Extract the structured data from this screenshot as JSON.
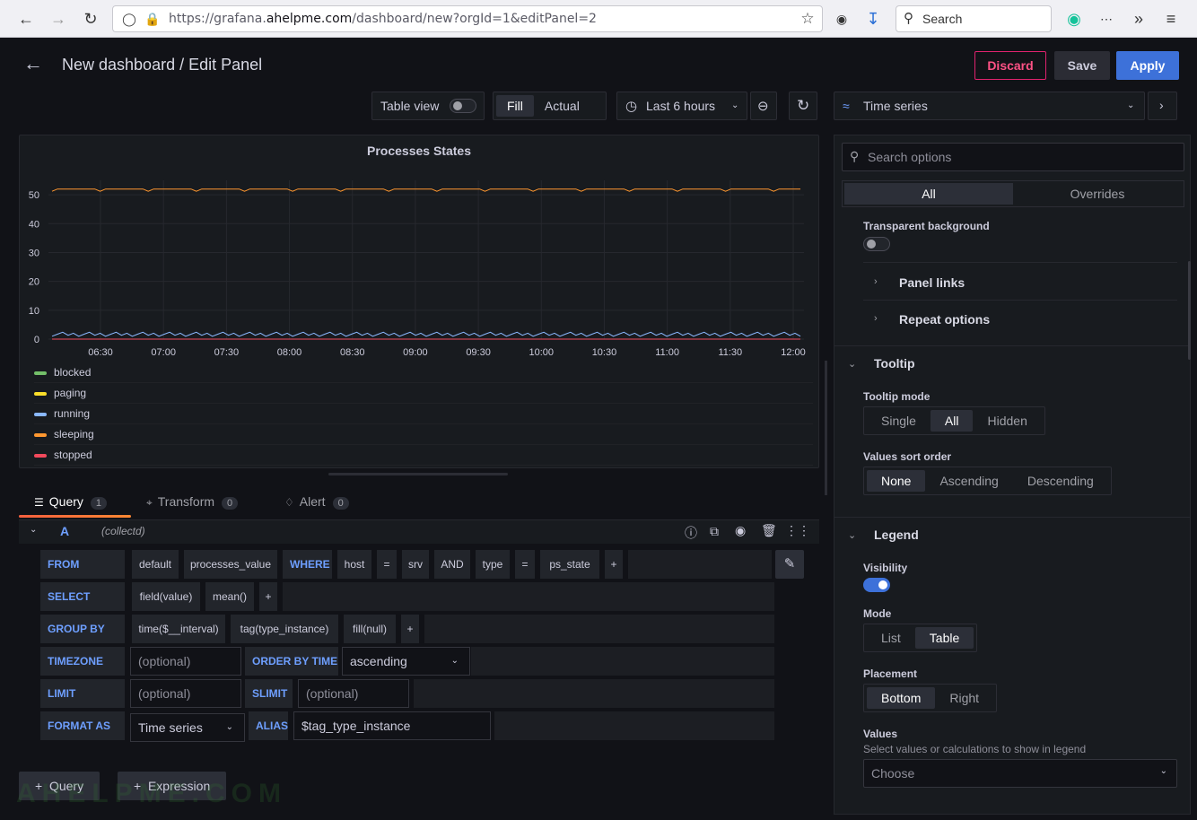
{
  "browser": {
    "url_prefix": "https://grafana.",
    "url_domain": "ahelpme.com",
    "url_path": "/dashboard/new?orgId=1&editPanel=2",
    "search_placeholder": "Search"
  },
  "header": {
    "title": "New dashboard / Edit Panel",
    "discard_label": "Discard",
    "save_label": "Save",
    "apply_label": "Apply"
  },
  "toolbar": {
    "table_view_label": "Table view",
    "fill_label": "Fill",
    "actual_label": "Actual",
    "time_range": "Last 6 hours",
    "visualization": "Time series"
  },
  "colors": {
    "accent": "#3d71d9",
    "discard": "#e0226e",
    "blocked": "#73bf69",
    "paging": "#fade2a",
    "running": "#8ab8ff",
    "sleeping": "#ff9830",
    "stopped": "#f2495c"
  },
  "chart_data": {
    "type": "line",
    "title": "Processes States",
    "xlabel": "",
    "ylabel": "",
    "x_ticks": [
      "06:30",
      "07:00",
      "07:30",
      "08:00",
      "08:30",
      "09:00",
      "09:30",
      "10:00",
      "10:30",
      "11:00",
      "11:30",
      "12:00"
    ],
    "y_ticks": [
      "0",
      "10",
      "20",
      "30",
      "40",
      "50"
    ],
    "ylim": [
      0,
      55
    ],
    "grid": true,
    "legend_placement": "bottom",
    "series": [
      {
        "name": "blocked",
        "color": "#73bf69",
        "values": [
          0,
          0,
          0,
          0,
          0,
          0,
          0,
          0,
          0,
          0,
          0,
          0
        ]
      },
      {
        "name": "paging",
        "color": "#fade2a",
        "values": [
          0,
          0,
          0,
          0,
          0,
          0,
          0,
          0,
          0,
          0,
          0,
          0
        ]
      },
      {
        "name": "running",
        "color": "#8ab8ff",
        "values": [
          1,
          1,
          1,
          1,
          1,
          1,
          1,
          1,
          1,
          1,
          1,
          1
        ]
      },
      {
        "name": "sleeping",
        "color": "#ff9830",
        "values": [
          52,
          52,
          52,
          52,
          52,
          52,
          52,
          52,
          52,
          52,
          52,
          52
        ]
      },
      {
        "name": "stopped",
        "color": "#f2495c",
        "values": [
          0,
          0,
          0,
          0,
          0,
          0,
          0,
          0,
          0,
          0,
          0,
          0
        ]
      }
    ]
  },
  "tabs": [
    {
      "label": "Query",
      "count": "1"
    },
    {
      "label": "Transform",
      "count": "0"
    },
    {
      "label": "Alert",
      "count": "0"
    }
  ],
  "query": {
    "letter": "A",
    "datasource": "(collectd)",
    "from": {
      "kw": "FROM",
      "policy": "default",
      "measurement": "processes_value",
      "where_kw": "WHERE",
      "t1": "host",
      "op1": "=",
      "v1": "srv",
      "and": "AND",
      "t2": "type",
      "op2": "=",
      "v2": "ps_state",
      "plus": "+"
    },
    "select": {
      "kw": "SELECT",
      "f1": "field(value)",
      "f2": "mean()",
      "plus": "+"
    },
    "group_by": {
      "kw": "GROUP BY",
      "g1": "time($__interval)",
      "g2": "tag(type_instance)",
      "g3": "fill(null)",
      "plus": "+"
    },
    "timezone": {
      "kw": "TIMEZONE",
      "placeholder": "(optional)",
      "order_kw": "ORDER BY TIME",
      "order_value": "ascending"
    },
    "limit": {
      "kw": "LIMIT",
      "placeholder": "(optional)",
      "slimit_kw": "SLIMIT",
      "slimit_placeholder": "(optional)"
    },
    "format": {
      "kw": "FORMAT AS",
      "value": "Time series",
      "alias_kw": "ALIAS",
      "alias_value": "$tag_type_instance"
    },
    "add_query_label": "Query",
    "add_expression_label": "Expression"
  },
  "watermark": "AHELPME.COM",
  "options": {
    "search_placeholder": "Search options",
    "tab_all": "All",
    "tab_overrides": "Overrides",
    "transparent_bg": "Transparent background",
    "panel_links": "Panel links",
    "repeat_options": "Repeat options",
    "tooltip": "Tooltip",
    "tooltip_mode": "Tooltip mode",
    "tooltip_modes": [
      "Single",
      "All",
      "Hidden"
    ],
    "sort_order": "Values sort order",
    "sort_orders": [
      "None",
      "Ascending",
      "Descending"
    ],
    "legend": "Legend",
    "visibility": "Visibility",
    "mode": "Mode",
    "modes": [
      "List",
      "Table"
    ],
    "placement": "Placement",
    "placements": [
      "Bottom",
      "Right"
    ],
    "values": "Values",
    "values_desc": "Select values or calculations to show in legend",
    "values_placeholder": "Choose"
  }
}
